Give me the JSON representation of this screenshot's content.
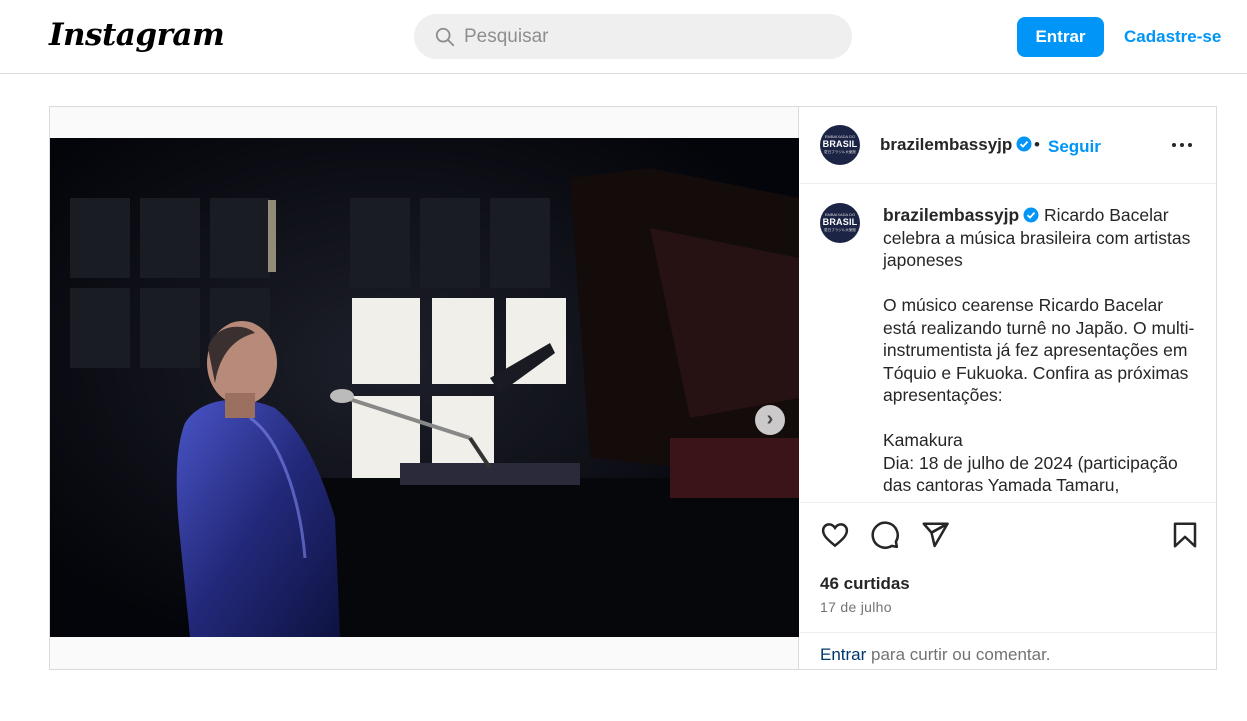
{
  "nav": {
    "logo_text": "Instagram",
    "search_placeholder": "Pesquisar",
    "login_label": "Entrar",
    "signup_label": "Cadastre-se"
  },
  "post": {
    "username": "brazilembassyjp",
    "follow_label": "Seguir",
    "separator": "•",
    "avatar": {
      "top_text": "EMBAIXADA DO",
      "main_text": "BRASIL",
      "sub_text": "駐日ブラジル大使館"
    },
    "caption": {
      "title": "Ricardo Bacelar celebra a música brasileira com artistas japoneses",
      "paragraph1": "O músico cearense Ricardo Bacelar está realizando turnê no Japão. O multi-instrumentista já fez apresentações em Tóquio e Fukuoka. Confira as próximas apresentações:",
      "line_location": "Kamakura",
      "line_date": "Dia: 18 de julho de 2024 (participação das cantoras Yamada Tamaru,"
    },
    "likes": "46 curtidas",
    "date": "17 de julho",
    "comment_login": "Entrar",
    "comment_text": "para curtir ou comentar.",
    "carousel": {
      "total": 2,
      "active_index": 0,
      "next_icon": "chevron-right-icon"
    }
  },
  "colors": {
    "accent": "#0095f6",
    "link_dark": "#00376b",
    "avatar_bg": "#1c2446",
    "border": "#dbdbdb"
  },
  "icons": [
    "search-icon",
    "verified-badge-icon",
    "more-options-icon",
    "heart-icon",
    "comment-icon",
    "share-icon",
    "bookmark-icon"
  ]
}
